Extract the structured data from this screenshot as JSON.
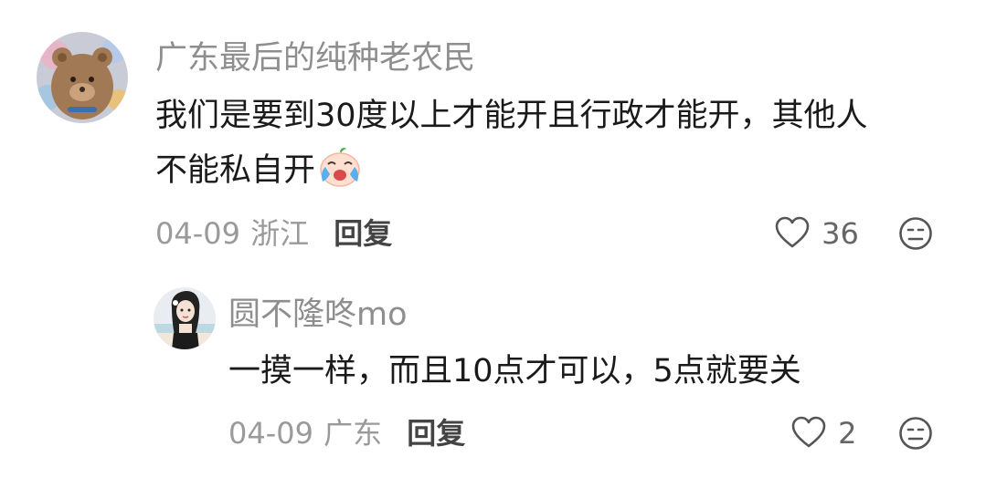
{
  "comments": [
    {
      "username": "广东最后的纯种老农民",
      "text_line1": "我们是要到30度以上才能开且行政才能开，其他人",
      "text_line2": "不能私自开",
      "emoji": "crying-laughing-emoji",
      "date": "04-09",
      "location": "浙江",
      "reply_label": "回复",
      "likes": "36"
    },
    {
      "username": "圆不隆咚mo",
      "text": "一摸一样，而且10点才可以，5点就要关",
      "date": "04-09",
      "location": "广东",
      "reply_label": "回复",
      "likes": "2"
    }
  ],
  "icons": {
    "like": "heart-outline-icon",
    "dislike": "neutral-face-icon"
  },
  "colors": {
    "username": "#8e8e8e",
    "text": "#1a1a1a",
    "meta": "#9a9a9a",
    "icon": "#555555"
  }
}
